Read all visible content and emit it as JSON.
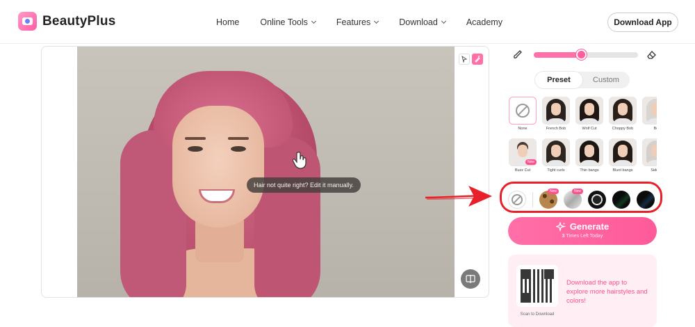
{
  "app": {
    "name": "BeautyPlus"
  },
  "nav": {
    "items": [
      {
        "label": "Home",
        "has_dropdown": false
      },
      {
        "label": "Online Tools",
        "has_dropdown": true
      },
      {
        "label": "Features",
        "has_dropdown": true
      },
      {
        "label": "Download",
        "has_dropdown": true
      },
      {
        "label": "Academy",
        "has_dropdown": false
      }
    ],
    "cta": "Download App"
  },
  "canvas": {
    "tooltip": "Hair not quite right? Edit it manually.",
    "tools": [
      "pointer-icon",
      "eraser-brush-icon"
    ]
  },
  "panel": {
    "brush_size_fraction": 0.45,
    "tabs": [
      {
        "label": "Preset",
        "active": true
      },
      {
        "label": "Custom",
        "active": false
      }
    ],
    "styles": [
      {
        "label": "None",
        "kind": "none",
        "selected": true
      },
      {
        "label": "French Bob",
        "new": false
      },
      {
        "label": "Wolf Cut",
        "new": false
      },
      {
        "label": "Choppy Bob",
        "new": false
      },
      {
        "label": "Bo",
        "new": false
      },
      {
        "label": "Buzz Cut",
        "new": true
      },
      {
        "label": "Tight curls",
        "new": false
      },
      {
        "label": "Thin bangs",
        "new": false
      },
      {
        "label": "Blunt bangs",
        "new": false
      },
      {
        "label": "Side b",
        "new": false
      }
    ],
    "new_badge": "New",
    "colors": [
      {
        "name": "none",
        "value": "none"
      },
      {
        "name": "leopard",
        "value": "#b8864d",
        "new": true
      },
      {
        "name": "silver",
        "value": "#c9c9c9",
        "new": true
      },
      {
        "name": "black-white",
        "value": "#1a1a1a"
      },
      {
        "name": "black-green",
        "value": "#14361f"
      },
      {
        "name": "black-blue",
        "value": "#142a45"
      }
    ],
    "generate": {
      "label": "Generate",
      "count": "3",
      "sub": "Times Left Today"
    },
    "promo": {
      "text": "Download the app to explore more hairstyles and colors!",
      "qr_label": "Scan to Download"
    }
  },
  "accent": "#ff5c9d",
  "highlight_color": "#e8202a"
}
